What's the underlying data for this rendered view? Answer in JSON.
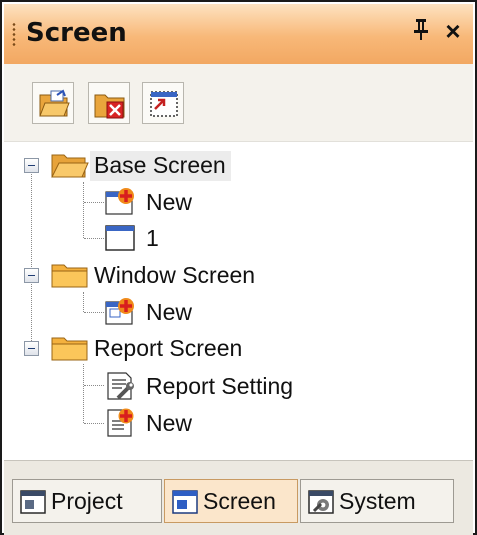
{
  "panel": {
    "title": "Screen",
    "pin_glyph": "ᵖ",
    "close_glyph": "×",
    "accent_color": "#f8b878"
  },
  "toolbar": {
    "buttons": [
      {
        "name": "open-folder-icon"
      },
      {
        "name": "delete-folder-icon"
      },
      {
        "name": "screen-properties-icon"
      }
    ]
  },
  "tree": {
    "groups": [
      {
        "label": "Base Screen",
        "icon": "open-folder-icon",
        "expanded": true,
        "selected": true,
        "children": [
          {
            "label": "New",
            "icon": "new-screen-icon"
          },
          {
            "label": "1",
            "icon": "window-screen-icon"
          }
        ]
      },
      {
        "label": "Window Screen",
        "icon": "folder-icon",
        "expanded": true,
        "children": [
          {
            "label": "New",
            "icon": "new-screen-icon"
          }
        ]
      },
      {
        "label": "Report Screen",
        "icon": "folder-icon",
        "expanded": true,
        "children": [
          {
            "label": "Report Setting",
            "icon": "report-setting-icon"
          },
          {
            "label": "New",
            "icon": "new-report-icon"
          }
        ]
      }
    ]
  },
  "tabs": [
    {
      "label": "Project",
      "icon": "project-tab-icon",
      "active": false
    },
    {
      "label": "Screen",
      "icon": "screen-tab-icon",
      "active": true
    },
    {
      "label": "System",
      "icon": "system-tab-icon",
      "active": false
    }
  ]
}
